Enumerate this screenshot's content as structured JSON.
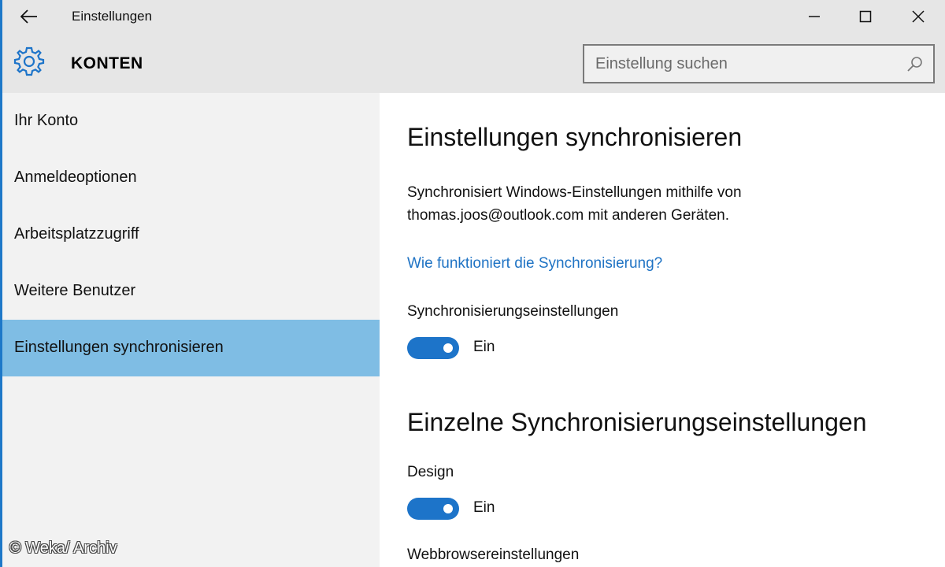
{
  "window": {
    "title": "Einstellungen",
    "controls": [
      "minimize-icon",
      "maximize-icon",
      "close-icon"
    ]
  },
  "header": {
    "icon": "gear-icon",
    "section": "KONTEN",
    "search": {
      "placeholder": "Einstellung suchen",
      "value": "",
      "icon": "search-icon"
    }
  },
  "sidebar": {
    "items": [
      {
        "label": "Ihr Konto",
        "selected": false
      },
      {
        "label": "Anmeldeoptionen",
        "selected": false
      },
      {
        "label": "Arbeitsplatzzugriff",
        "selected": false
      },
      {
        "label": "Weitere Benutzer",
        "selected": false
      },
      {
        "label": "Einstellungen synchronisieren",
        "selected": true
      }
    ]
  },
  "main": {
    "heading": "Einstellungen synchronisieren",
    "description": "Synchronisiert Windows-Einstellungen mithilfe von thomas.joos@outlook.com mit anderen Geräten.",
    "link": "Wie funktioniert die Synchronisierung?",
    "sync_settings": {
      "label": "Synchronisierungseinstellungen",
      "state": "Ein",
      "on": true
    },
    "subheading": "Einzelne Synchronisierungseinstellungen",
    "design": {
      "label": "Design",
      "state": "Ein",
      "on": true
    },
    "browser": {
      "label": "Webbrowsereinstellungen"
    }
  },
  "colors": {
    "accent": "#1d74c9",
    "selected_nav": "#7fbde4",
    "link": "#1f73c4"
  },
  "watermark": "© Weka/ Archiv"
}
